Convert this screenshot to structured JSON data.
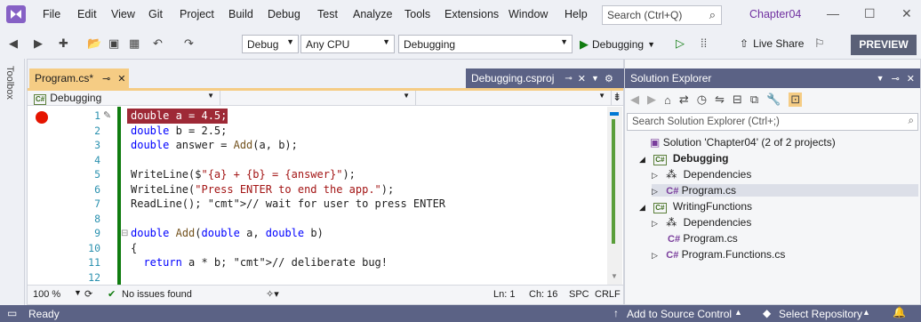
{
  "menubar": {
    "items": [
      "File",
      "Edit",
      "View",
      "Git",
      "Project",
      "Build",
      "Debug",
      "Test",
      "Analyze",
      "Tools",
      "Extensions",
      "Window",
      "Help"
    ],
    "search_placeholder": "Search (Ctrl+Q)",
    "solution_title": "Chapter04"
  },
  "toolbar": {
    "config": "Debug",
    "platform": "Any CPU",
    "startup_project": "Debugging",
    "run_label": "Debugging",
    "live_share": "Live Share",
    "preview": "PREVIEW"
  },
  "toolbox_label": "Toolbox",
  "editor": {
    "active_tab": "Program.cs*",
    "inactive_tab": "Debugging.csproj",
    "nav_project": "Debugging",
    "lines": [
      {
        "n": "1",
        "text": "double a = 4.5;"
      },
      {
        "n": "2",
        "text": "double b = 2.5;"
      },
      {
        "n": "3",
        "text": "double answer = Add(a, b);"
      },
      {
        "n": "4",
        "text": ""
      },
      {
        "n": "5",
        "text": "WriteLine($\"{a} + {b} = {answer}\");"
      },
      {
        "n": "6",
        "text": "WriteLine(\"Press ENTER to end the app.\");"
      },
      {
        "n": "7",
        "text": "ReadLine(); // wait for user to press ENTER"
      },
      {
        "n": "8",
        "text": ""
      },
      {
        "n": "9",
        "text": "double Add(double a, double b)"
      },
      {
        "n": "10",
        "text": "{"
      },
      {
        "n": "11",
        "text": "  return a * b; // deliberate bug!"
      },
      {
        "n": "12",
        "text": "}"
      }
    ],
    "zoom": "100 %",
    "issues": "No issues found",
    "ln": "Ln: 1",
    "ch": "Ch: 16",
    "spc": "SPC",
    "crlf": "CRLF"
  },
  "solution_explorer": {
    "title": "Solution Explorer",
    "search_placeholder": "Search Solution Explorer (Ctrl+;)",
    "solution": "Solution 'Chapter04' (2 of 2 projects)",
    "project1": "Debugging",
    "dependencies": "Dependencies",
    "program_cs": "Program.cs",
    "project2": "WritingFunctions",
    "program_functions": "Program.Functions.cs"
  },
  "statusbar": {
    "ready": "Ready",
    "source_control": "Add to Source Control",
    "select_repo": "Select Repository"
  }
}
